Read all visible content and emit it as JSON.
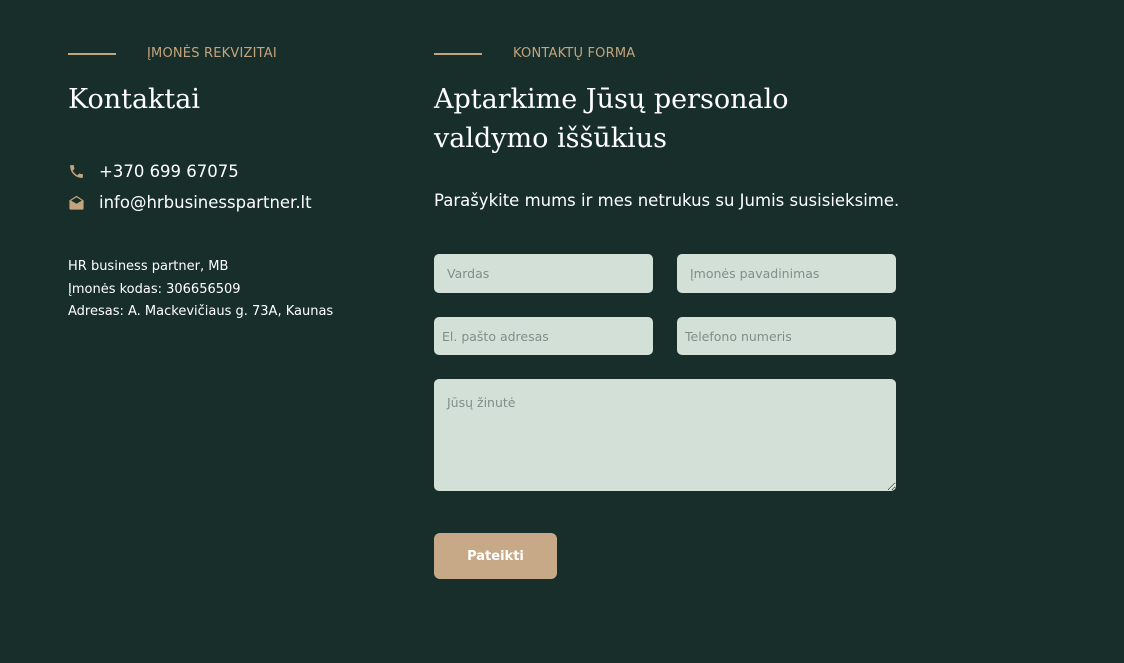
{
  "colors": {
    "background": "#172e2b",
    "accent": "#c4a47c",
    "field_bg": "#d3e0d8",
    "button_bg": "#c8a987",
    "text": "#ffffff"
  },
  "company_section": {
    "eyebrow": "Įmonės rekvizitai",
    "title": "Kontaktai",
    "phone": {
      "icon": "phone-icon",
      "value": "+370 699 67075"
    },
    "email": {
      "icon": "envelope-open-icon",
      "value": "info@hrbusinesspartner.lt"
    },
    "details": [
      "HR business partner, MB",
      "Įmonės kodas: 306656509",
      "Adresas: A. Mackevičiaus g. 73A, Kaunas"
    ]
  },
  "form_section": {
    "eyebrow": "Kontaktų forma",
    "title_line1": "Aptarkime Jūsų personalo",
    "title_line2": "valdymo iššūkius",
    "lead": "Parašykite mums ir mes netrukus su Jumis susisieksime.",
    "fields": {
      "name": {
        "placeholder": "Vardas",
        "value": ""
      },
      "company": {
        "placeholder": "Įmonės pavadinimas",
        "value": ""
      },
      "email": {
        "placeholder": "El. pašto adresas",
        "value": ""
      },
      "phone": {
        "placeholder": "Telefono numeris",
        "value": ""
      },
      "message": {
        "placeholder": "Jūsų žinutė",
        "value": ""
      }
    },
    "submit_label": "Pateikti"
  }
}
